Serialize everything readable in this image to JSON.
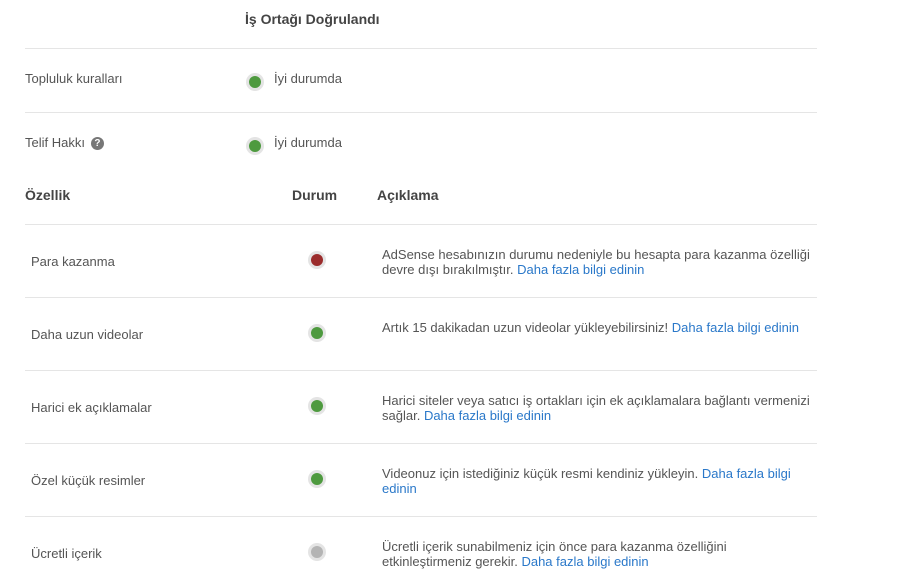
{
  "partner": {
    "title": "İş Ortağı Doğrulandı"
  },
  "status_rows": [
    {
      "label": "Topluluk kuralları",
      "status": "İyi durumda"
    },
    {
      "label": "Telif Hakkı",
      "status": "İyi durumda",
      "help_icon": "?"
    }
  ],
  "table": {
    "headers": {
      "feature": "Özellik",
      "status": "Durum",
      "description": "Açıklama"
    },
    "rows": [
      {
        "feature": "Para kazanma",
        "status": "red",
        "description": "AdSense hesabınızın durumu nedeniyle bu hesapta para kazanma özelliği devre dışı bırakılmıştır.",
        "link": "Daha fazla bilgi edinin"
      },
      {
        "feature": "Daha uzun videolar",
        "status": "green",
        "description": "Artık 15 dakikadan uzun videolar yükleyebilirsiniz!",
        "link": "Daha fazla bilgi edinin"
      },
      {
        "feature": "Harici ek açıklamalar",
        "status": "green",
        "description": "Harici siteler veya satıcı iş ortakları için ek açıklamalara bağlantı vermenizi sağlar.",
        "link": "Daha fazla bilgi edinin"
      },
      {
        "feature": "Özel küçük resimler",
        "status": "green",
        "description": "Videonuz için istediğiniz küçük resmi kendiniz yükleyin.",
        "link": "Daha fazla bilgi edinin"
      },
      {
        "feature": "Ücretli içerik",
        "status": "grey",
        "description": "Ücretli içerik sunabilmeniz için önce para kazanma özelliğini etkinleştirmeniz gerekir.",
        "link": "Daha fazla bilgi edinin"
      }
    ]
  }
}
